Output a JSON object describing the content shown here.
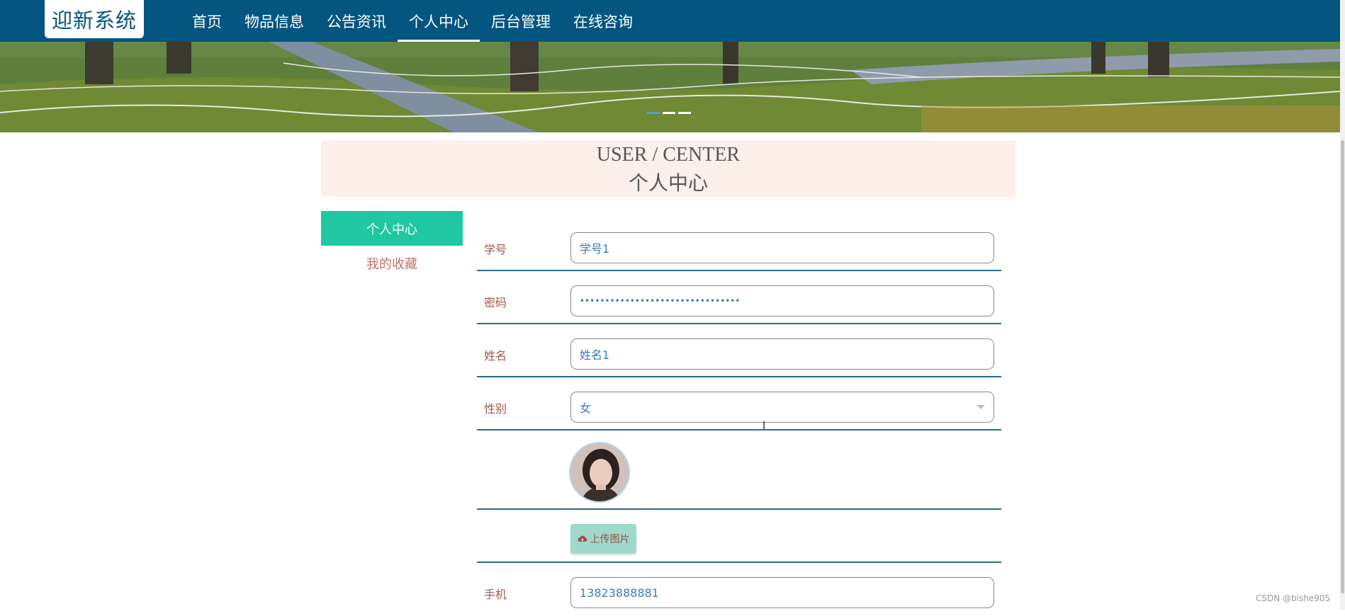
{
  "header": {
    "logo": "迎新系统",
    "nav": [
      {
        "label": "首页",
        "active": false
      },
      {
        "label": "物品信息",
        "active": false
      },
      {
        "label": "公告资讯",
        "active": false
      },
      {
        "label": "个人中心",
        "active": true
      },
      {
        "label": "后台管理",
        "active": false
      },
      {
        "label": "在线咨询",
        "active": false
      }
    ]
  },
  "banner": {
    "slides": 3,
    "active_slide": 1
  },
  "page_title": {
    "en": "USER / CENTER",
    "cn": "个人中心"
  },
  "sidebar": {
    "items": [
      {
        "label": "个人中心",
        "active": true
      },
      {
        "label": "我的收藏",
        "active": false
      }
    ]
  },
  "form": {
    "student_id": {
      "label": "学号",
      "value": "学号1"
    },
    "password": {
      "label": "密码",
      "value": "••••••••••••••••••••••••••••••••"
    },
    "name": {
      "label": "姓名",
      "value": "姓名1"
    },
    "gender": {
      "label": "性别",
      "value": "女"
    },
    "upload_label": "上传图片",
    "phone": {
      "label": "手机",
      "value": "13823888881"
    }
  },
  "watermark": "CSDN @bishe905",
  "colors": {
    "topbar": "#04557f",
    "accent": "#1fc8a0",
    "title_bg": "#fdefe9",
    "label": "#a0584f",
    "value": "#3b7db6"
  }
}
